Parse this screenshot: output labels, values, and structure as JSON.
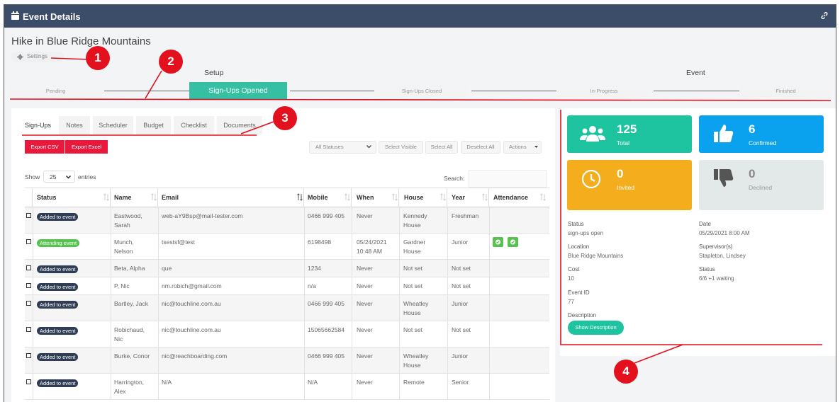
{
  "window": {
    "title": "Event Details"
  },
  "event": {
    "title": "Hike in Blue Ridge Mountains",
    "settings_label": "Settings"
  },
  "phases": {
    "setup": "Setup",
    "event": "Event"
  },
  "stages": [
    {
      "label": "Pending"
    },
    {
      "label": "Sign-Ups Opened"
    },
    {
      "label": "Sign-Ups Closed"
    },
    {
      "label": "In-Progress"
    },
    {
      "label": "Finished"
    }
  ],
  "tabs": [
    "Sign-Ups",
    "Notes",
    "Scheduler",
    "Budget",
    "Checklist",
    "Documents"
  ],
  "toolbar": {
    "export_csv": "Export CSV",
    "export_excel": "Export Excel",
    "status_filter": "All Statuses",
    "select_visible": "Select Visible",
    "select_all": "Select All",
    "deselect_all": "Deselect All",
    "actions": "Actions"
  },
  "table_controls": {
    "show": "Show",
    "entries_value": "25",
    "entries": "entries",
    "search": "Search:"
  },
  "table": {
    "columns": [
      "Status",
      "Name",
      "Email",
      "Mobile",
      "When",
      "House",
      "Year",
      "Attendance"
    ],
    "rows": [
      {
        "status": "Added to event",
        "name1": "Eastwood,",
        "name2": "Sarah",
        "email": "web-aY9Bsp@mail-tester.com",
        "mobile": "0466 999 405",
        "when1": "Never",
        "when2": "",
        "house1": "Kennedy",
        "house2": "House",
        "year": "Freshman"
      },
      {
        "status": "Attending event",
        "name1": "Munch,",
        "name2": "Nelson",
        "email": "tsestsf@test",
        "mobile": "6198498",
        "when1": "05/24/2021",
        "when2": "10:48 AM",
        "house1": "Gardner",
        "house2": "House",
        "year": "Junior"
      },
      {
        "status": "Added to event",
        "name1": "Beta, Alpha",
        "name2": "",
        "email": "que",
        "mobile": "1234",
        "when1": "Never",
        "when2": "",
        "house1": "Not set",
        "house2": "",
        "year": "Not set"
      },
      {
        "status": "Added to event",
        "name1": "P, Nic",
        "name2": "",
        "email": "nm.robich@gmail.com",
        "mobile": "n/a",
        "when1": "Never",
        "when2": "",
        "house1": "Not set",
        "house2": "",
        "year": "Not set"
      },
      {
        "status": "Added to event",
        "name1": "Bartley, Jack",
        "name2": "",
        "email": "nic@touchline.com.au",
        "mobile": "0466 999 405",
        "when1": "Never",
        "when2": "",
        "house1": "Wheatley",
        "house2": "House",
        "year": "Junior"
      },
      {
        "status": "Added to event",
        "name1": "Robichaud,",
        "name2": "Nic",
        "email": "nic@touchline.com.au",
        "mobile": "15065662584",
        "when1": "Never",
        "when2": "",
        "house1": "Not set",
        "house2": "",
        "year": "Not set"
      },
      {
        "status": "Added to event",
        "name1": "Burke, Conor",
        "name2": "",
        "email": "nic@reachboarding.com",
        "mobile": "0466 999 405",
        "when1": "Never",
        "when2": "",
        "house1": "Wheatley",
        "house2": "House",
        "year": "Junior"
      },
      {
        "status": "Added to event",
        "name1": "Harrington,",
        "name2": "Alex",
        "email": "N/A",
        "mobile": "N/A",
        "when1": "Never",
        "when2": "",
        "house1": "Remote",
        "house2": "",
        "year": "Senior"
      }
    ]
  },
  "stats": [
    {
      "value": "125",
      "label": "Total",
      "color": "#1ec3a0",
      "icon": "users-icon"
    },
    {
      "value": "6",
      "label": "Confirmed",
      "color": "#0aa1ef",
      "icon": "thumbs-up-icon"
    },
    {
      "value": "0",
      "label": "Invited",
      "color": "#f3ad1d",
      "icon": "clock-icon"
    },
    {
      "value": "0",
      "label": "Declined",
      "color": "#e3e8e8",
      "icon": "thumbs-down-icon"
    }
  ],
  "details": {
    "status_label": "Status",
    "status_value": "sign-ups open",
    "date_label": "Date",
    "date_value": "05/29/2021 8:00 AM",
    "location_label": "Location",
    "location_value": "Blue Ridge Mountains",
    "supervisors_label": "Supervisor(s)",
    "supervisors_value": "Stapleton, Lindsey",
    "cost_label": "Cost",
    "cost_value": "10",
    "capacity_label": "Status",
    "capacity_value": "6/6 +1 waiting",
    "event_id_label": "Event ID",
    "event_id_value": "77",
    "description_label": "Description",
    "show_description": "Show Description"
  },
  "callouts": [
    "1",
    "2",
    "3",
    "4"
  ],
  "colors": {
    "header": "#3b4d68",
    "accent": "#36c0a3",
    "red": "#e8193c",
    "badge_dark": "#2f3e55",
    "badge_green": "#57c24f"
  }
}
